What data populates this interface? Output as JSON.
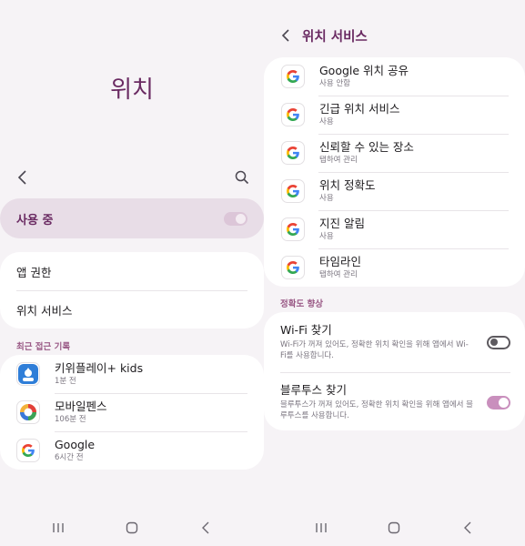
{
  "left": {
    "page_title": "위치",
    "master_toggle": {
      "label": "사용 중",
      "state": "on"
    },
    "menu": [
      {
        "label": "앱 권한"
      },
      {
        "label": "위치 서비스"
      }
    ],
    "recent_header": "최근 접근 기록",
    "recent_apps": [
      {
        "name": "키위플레이+ kids",
        "time": "1분 전",
        "icon": "kiwiplay-kids-icon"
      },
      {
        "name": "모바일펜스",
        "time": "106분 전",
        "icon": "mobilefence-icon"
      },
      {
        "name": "Google",
        "time": "6시간 전",
        "icon": "google-icon"
      }
    ]
  },
  "right": {
    "header_title": "위치 서비스",
    "services": [
      {
        "name": "Google 위치 공유",
        "status": "사용 안함",
        "icon": "google-icon"
      },
      {
        "name": "긴급 위치 서비스",
        "status": "사용",
        "icon": "google-icon"
      },
      {
        "name": "신뢰할 수 있는 장소",
        "status": "탭하여 관리",
        "icon": "google-icon"
      },
      {
        "name": "위치 정확도",
        "status": "사용",
        "icon": "google-icon"
      },
      {
        "name": "지진 알림",
        "status": "사용",
        "icon": "google-icon"
      },
      {
        "name": "타임라인",
        "status": "탭하여 관리",
        "icon": "google-icon"
      }
    ],
    "accuracy_header": "정확도 향상",
    "scans": [
      {
        "title": "Wi-Fi 찾기",
        "desc": "Wi-Fi가 꺼져 있어도, 정확한 위치 확인을 위해 앱에서 Wi-Fi를 사용합니다.",
        "state": "off"
      },
      {
        "title": "블루투스 찾기",
        "desc": "블루투스가 꺼져 있어도, 정확한 위치 확인을 위해 앱에서 블루투스를 사용합니다.",
        "state": "on"
      }
    ]
  },
  "colors": {
    "accent": "#6a2a62",
    "toggle_on": "#c98fbd",
    "background": "#f6f3f6",
    "card": "#ffffff"
  }
}
